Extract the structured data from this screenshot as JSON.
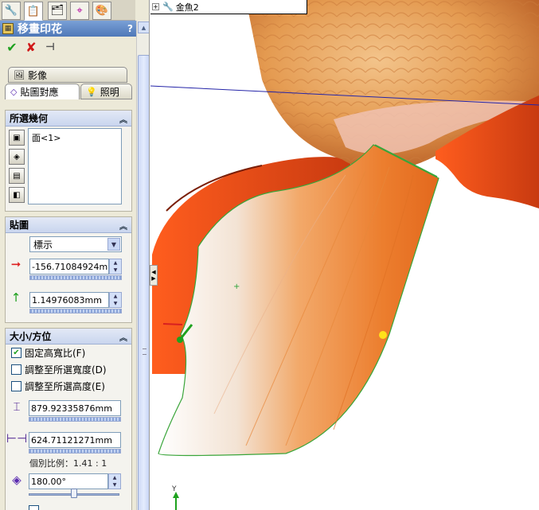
{
  "feature": {
    "title": "移畫印花",
    "help": "?"
  },
  "subtabs": {
    "image": "影像",
    "mapping": "貼圖對應",
    "lighting": "照明"
  },
  "selection": {
    "title": "所選幾何",
    "item": "面<1>"
  },
  "mapping": {
    "title": "貼圖",
    "type_value": "標示",
    "horizontal_value": "-156.71084924mm",
    "vertical_value": "1.14976083mm"
  },
  "size": {
    "title": "大小/方位",
    "fixed_aspect": "固定高寬比(F)",
    "fit_width": "調整至所選寬度(D)",
    "fit_height": "調整至所選高度(E)",
    "height_value": "879.92335876mm",
    "width_value": "624.71121271mm",
    "ratio_text": "個別比例：1.41 : 1",
    "angle_value": "180.00°",
    "angle_slider_fraction": 0.5
  },
  "tree": {
    "item": "金魚2"
  },
  "axis": {
    "y_label": "Y"
  },
  "colors": {
    "accent": "#4f78b8",
    "fin": "#e55a1c",
    "edge": "#2ea33a"
  }
}
